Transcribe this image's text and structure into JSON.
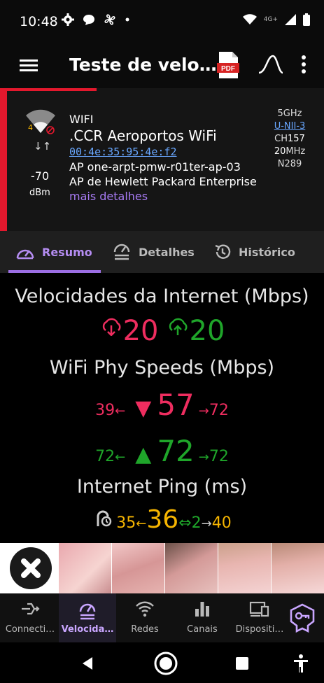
{
  "status_bar": {
    "time": "10:48",
    "network_label": "4G+"
  },
  "app_bar": {
    "title": "Teste de velo…",
    "pdf_label": "PDF"
  },
  "network": {
    "type": "WIFI",
    "ssid": ".CCR Aeroportos WiFi",
    "mac": "00:4e:35:95:4e:f2",
    "ap_name": "AP one-arpt-pmw-r01ter-ap-03",
    "vendor": "AP de Hewlett Packard Enterprise",
    "more_details": "mais detalhes",
    "signal_dbm": "-70",
    "signal_unit": "dBm",
    "wifi_generation": "4",
    "freq": "5GHz",
    "band": "U-NII-3",
    "channel_label": "CH",
    "channel": "157",
    "width_value": "20",
    "width_unit": "MHz",
    "noise": "N289"
  },
  "tabs": [
    {
      "label": "Resumo",
      "active": true
    },
    {
      "label": "Detalhes",
      "active": false
    },
    {
      "label": "Histórico",
      "active": false
    }
  ],
  "summary": {
    "internet_heading": "Velocidades da Internet (Mbps)",
    "internet_download": "20",
    "internet_upload": "20",
    "phy_heading": "WiFi Phy Speeds (Mbps)",
    "phy_rx": {
      "min": "39",
      "current": "57",
      "max": "72"
    },
    "phy_tx": {
      "min": "72",
      "current": "72",
      "max": "72"
    },
    "ping_heading": "Internet Ping (ms)",
    "ping": {
      "min": "35",
      "current": "36",
      "jitter": "2",
      "max": "40"
    }
  },
  "bottom_nav": [
    {
      "label": "Connecti…",
      "icon": "connections-icon",
      "active": false
    },
    {
      "label": "Velocida…",
      "icon": "speedometer-icon",
      "active": true
    },
    {
      "label": "Redes",
      "icon": "wifi-icon",
      "active": false
    },
    {
      "label": "Canais",
      "icon": "bar-chart-icon",
      "active": false
    },
    {
      "label": "Dispositi…",
      "icon": "devices-icon",
      "active": false
    }
  ],
  "colors": {
    "accent": "#9c6fe4",
    "download": "#ee2d5f",
    "upload": "#1fa52a",
    "ping": "#f5b400",
    "signal_bar": "#e3182d"
  }
}
